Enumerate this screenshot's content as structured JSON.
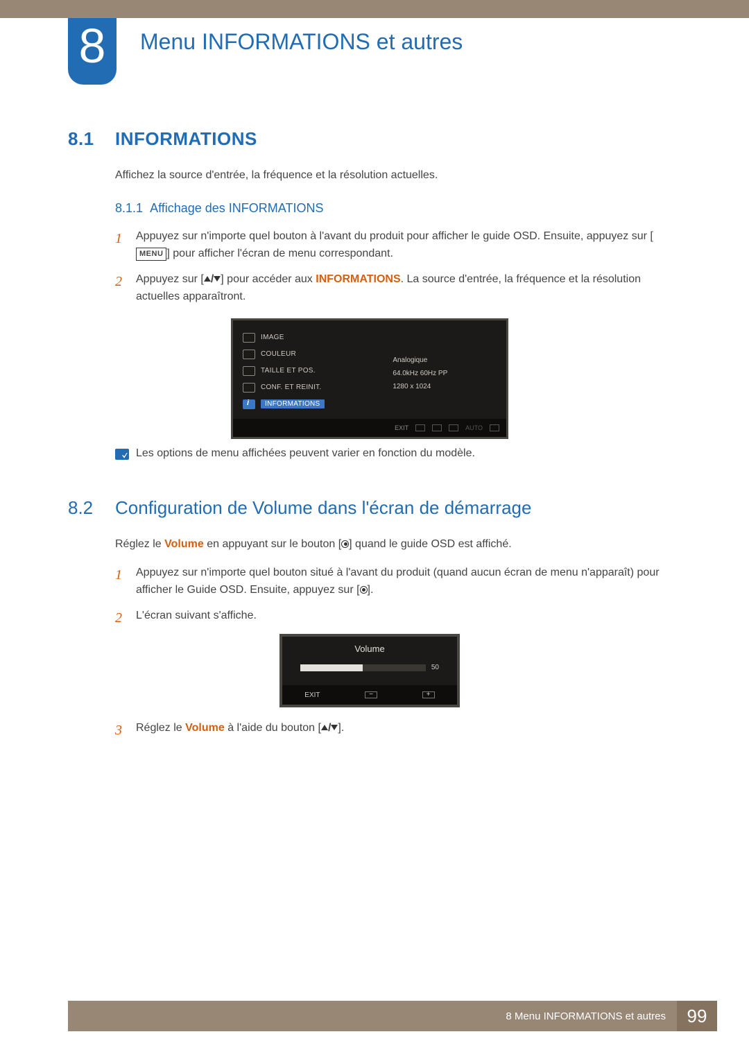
{
  "chapter": {
    "number": "8",
    "title": "Menu INFORMATIONS et autres"
  },
  "sec81": {
    "num": "8.1",
    "title": "INFORMATIONS",
    "intro": "Affichez la source d'entrée, la fréquence et la résolution actuelles.",
    "sub": {
      "num": "8.1.1",
      "title": "Affichage des INFORMATIONS"
    },
    "step1a": "Appuyez sur n'importe quel bouton à l'avant du produit pour afficher le guide OSD. Ensuite, appuyez sur [",
    "step1b": "] pour afficher l'écran de menu correspondant.",
    "menuLabel": "MENU",
    "step2a": "Appuyez sur [",
    "step2b": "] pour accéder aux ",
    "step2kw": "INFORMATIONS",
    "step2c": ". La source d'entrée, la fréquence et la résolution actuelles apparaîtront.",
    "note": "Les options de menu affichées peuvent varier en fonction du modèle."
  },
  "osd": {
    "items": [
      "IMAGE",
      "COULEUR",
      "TAILLE ET POS.",
      "CONF. ET REINIT.",
      "INFORMATIONS"
    ],
    "info": [
      "Analogique",
      "64.0kHz 60Hz PP",
      "1280 x 1024"
    ],
    "footExit": "EXIT",
    "footAuto": "AUTO"
  },
  "sec82": {
    "num": "8.2",
    "title": "Configuration de Volume dans l'écran de démarrage",
    "introA": "Réglez le ",
    "introKW": "Volume",
    "introB": " en appuyant sur le bouton [",
    "introC": "] quand le guide OSD est affiché.",
    "step1a": "Appuyez sur n'importe quel bouton situé à l'avant du produit (quand aucun écran de menu n'apparaît) pour afficher le Guide OSD. Ensuite, appuyez sur [",
    "step1b": "].",
    "step2": "L'écran suivant s'affiche.",
    "step3a": "Réglez le ",
    "step3kw": "Volume",
    "step3b": " à l'aide du bouton [",
    "step3c": "]."
  },
  "vol": {
    "title": "Volume",
    "value": "50",
    "exit": "EXIT",
    "minus": "−",
    "plus": "+"
  },
  "footer": {
    "text": "8 Menu INFORMATIONS et autres",
    "page": "99"
  }
}
